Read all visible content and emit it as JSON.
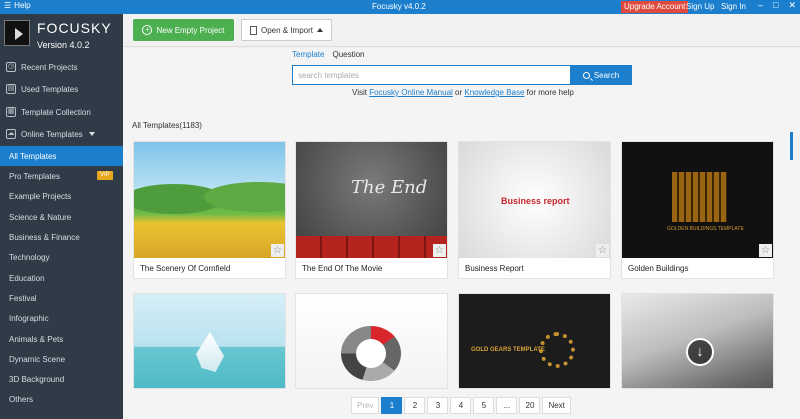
{
  "titlebar": {
    "help": "Help",
    "title": "Focusky v4.0.2",
    "upgrade": "Upgrade Account",
    "signup": "Sign Up",
    "signin": "Sign In"
  },
  "sidebar": {
    "brand": "FOCUSKY",
    "version": "Version 4.0.2",
    "items": [
      {
        "label": "Recent Projects",
        "icon": "clock-icon"
      },
      {
        "label": "Used Templates",
        "icon": "template-icon"
      },
      {
        "label": "Template Collection",
        "icon": "collection-icon"
      },
      {
        "label": "Online Templates",
        "icon": "cloud-icon"
      }
    ],
    "subitems": [
      {
        "label": "All Templates"
      },
      {
        "label": "Pro Templates"
      },
      {
        "label": "Example Projects"
      },
      {
        "label": "Science & Nature"
      },
      {
        "label": "Business & Finance"
      },
      {
        "label": "Technology"
      },
      {
        "label": "Education"
      },
      {
        "label": "Festival"
      },
      {
        "label": "Infographic"
      },
      {
        "label": "Animals & Pets"
      },
      {
        "label": "Dynamic Scene"
      },
      {
        "label": "3D Background"
      },
      {
        "label": "Others"
      }
    ],
    "vip": "VIP"
  },
  "toolbar": {
    "new_label": "New Empty Project",
    "open_label": "Open & Import"
  },
  "search": {
    "tab_template": "Template",
    "tab_question": "Question",
    "placeholder": "search templates",
    "button": "Search",
    "visit": "Visit",
    "manual": "Focusky Online Manual",
    "or": "or",
    "kb": "Knowledge Base",
    "more": "for more help"
  },
  "section_title": "All Templates(1183)",
  "cards": [
    {
      "caption": "The Scenery Of Cornfield"
    },
    {
      "caption": "The End Of The Movie",
      "thumb_text": "The End"
    },
    {
      "caption": "Business Report",
      "thumb_text": "Business report"
    },
    {
      "caption": "Golden Buildings",
      "thumb_text": "GOLDEN BUILDINGS TEMPLATE"
    },
    {
      "caption": ""
    },
    {
      "caption": ""
    },
    {
      "caption": "",
      "thumb_text": "GOLD GEARS TEMPLATE"
    },
    {
      "caption": ""
    }
  ],
  "pager": [
    "Prev",
    "1",
    "2",
    "3",
    "4",
    "5",
    "...",
    "20",
    "Next"
  ],
  "colors": {
    "accent": "#1b7fce",
    "sidebar": "#2f3b46",
    "green": "#4caf50",
    "upgrade": "#e04a3d"
  }
}
